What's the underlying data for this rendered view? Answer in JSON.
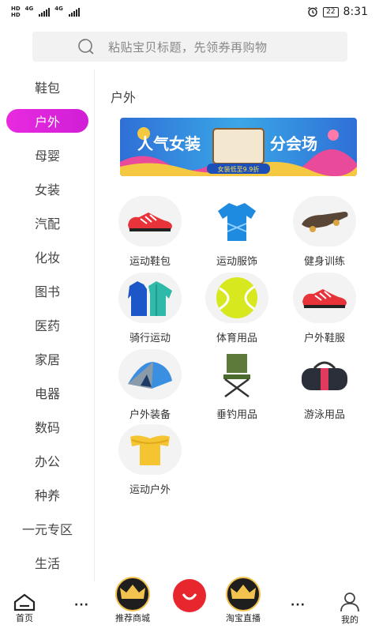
{
  "status_bar": {
    "sim1": "HD",
    "sim2": "HD",
    "net1": "4G",
    "net2": "4G",
    "battery": "22",
    "time": "8:31"
  },
  "search": {
    "placeholder": "粘贴宝贝标题，先领券再购物"
  },
  "sidebar": {
    "items": [
      {
        "label": "鞋包"
      },
      {
        "label": "户外"
      },
      {
        "label": "母婴"
      },
      {
        "label": "女装"
      },
      {
        "label": "汽配"
      },
      {
        "label": "化妆"
      },
      {
        "label": "图书"
      },
      {
        "label": "医药"
      },
      {
        "label": "家居"
      },
      {
        "label": "电器"
      },
      {
        "label": "数码"
      },
      {
        "label": "办公"
      },
      {
        "label": "种养"
      },
      {
        "label": "一元专区"
      },
      {
        "label": "生活"
      }
    ],
    "active_index": 1
  },
  "main": {
    "title": "户外",
    "banner": {
      "headline_left": "人气女装",
      "headline_right": "分会场",
      "sub": "女装低至9.9折"
    },
    "categories": [
      {
        "label": "运动鞋包",
        "icon": "sneaker-icon"
      },
      {
        "label": "运动服饰",
        "icon": "sports-shirt-icon"
      },
      {
        "label": "健身训练",
        "icon": "skateboard-icon"
      },
      {
        "label": "骑行运动",
        "icon": "jackets-icon"
      },
      {
        "label": "体育用品",
        "icon": "tennis-ball-icon"
      },
      {
        "label": "户外鞋服",
        "icon": "sneaker-icon"
      },
      {
        "label": "户外装备",
        "icon": "tent-icon"
      },
      {
        "label": "垂钓用品",
        "icon": "folding-chair-icon"
      },
      {
        "label": "游泳用品",
        "icon": "duffel-bag-icon"
      },
      {
        "label": "运动户外",
        "icon": "blouse-icon"
      }
    ]
  },
  "bottom_nav": {
    "home": "首页",
    "recommend": "推荐商城",
    "live": "淘宝直播",
    "mine": "我的",
    "dots": "···"
  },
  "colors": {
    "accent": "#e02ad8",
    "center_button": "#e8262e",
    "crown_bg": "#1e1e1e",
    "crown": "#f2c14e"
  }
}
